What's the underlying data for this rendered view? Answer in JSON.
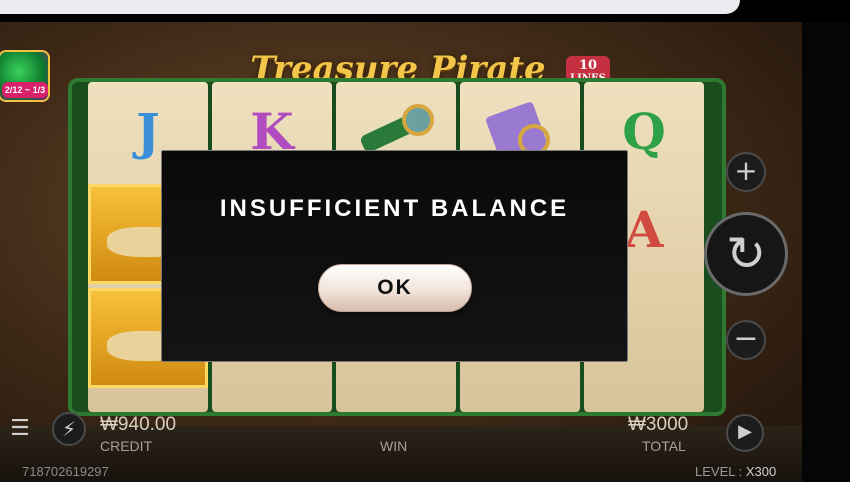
{
  "game": {
    "logo_text": "Treasure Pirate",
    "lines_badge": {
      "number": "10",
      "label": "LINES"
    },
    "promo_date": "2/12 ~ 1/3"
  },
  "reels": {
    "top_row": [
      "J",
      "K",
      "spyglass",
      "map",
      "Q"
    ],
    "col5_row2": "A"
  },
  "modal": {
    "title": "INSUFFICIENT BALANCE",
    "ok_label": "OK"
  },
  "hud": {
    "credit_value": "₩940.00",
    "credit_label": "CREDIT",
    "win_label": "WIN",
    "total_value": "₩3000",
    "total_label": "TOTAL"
  },
  "controls": {
    "plus_icon": "plus-icon",
    "minus_icon": "minus-icon",
    "spin_icon": "spin-refresh-icon",
    "menu_icon": "menu-icon",
    "turbo_icon": "lightning-icon",
    "autoplay_icon": "autoplay-icon"
  },
  "footer": {
    "session_id": "718702619297",
    "level_label": "LEVEL",
    "level_value": "X300"
  },
  "colors": {
    "modal_bg": "#0d0d0d",
    "gold": "#f3c64a",
    "board_green": "#2e7a30"
  }
}
